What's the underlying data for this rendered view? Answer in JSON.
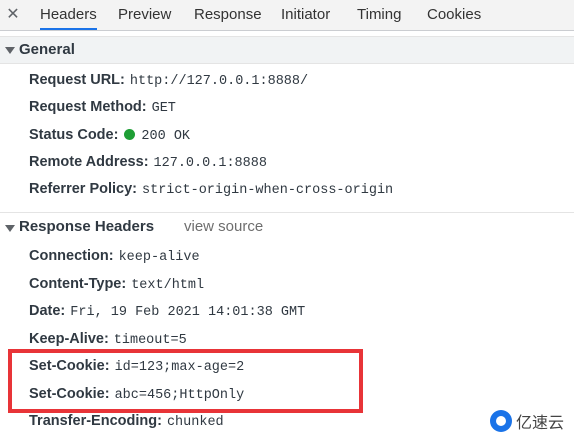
{
  "tabs": {
    "close_icon": "✕",
    "items": [
      "Headers",
      "Preview",
      "Response",
      "Initiator",
      "Timing",
      "Cookies"
    ],
    "active": "Headers"
  },
  "general": {
    "title": "General",
    "request_url_key": "Request URL:",
    "request_url_val": "http://127.0.0.1:8888/",
    "request_method_key": "Request Method:",
    "request_method_val": "GET",
    "status_code_key": "Status Code:",
    "status_code_val": "200 OK",
    "status_color": "#1e9e35",
    "remote_address_key": "Remote Address:",
    "remote_address_val": "127.0.0.1:8888",
    "referrer_policy_key": "Referrer Policy:",
    "referrer_policy_val": "strict-origin-when-cross-origin"
  },
  "response_headers": {
    "title": "Response Headers",
    "view_source": "view source",
    "connection_key": "Connection:",
    "connection_val": "keep-alive",
    "content_type_key": "Content-Type:",
    "content_type_val": "text/html",
    "date_key": "Date:",
    "date_val": "Fri, 19 Feb 2021 14:01:38 GMT",
    "keep_alive_key": "Keep-Alive:",
    "keep_alive_val": "timeout=5",
    "set_cookie_1_key": "Set-Cookie:",
    "set_cookie_1_val": "id=123;max-age=2",
    "set_cookie_2_key": "Set-Cookie:",
    "set_cookie_2_val": "abc=456;HttpOnly",
    "transfer_encoding_key": "Transfer-Encoding:",
    "transfer_encoding_val": "chunked"
  },
  "annotation": {
    "highlight_color": "#e83438"
  },
  "watermark": {
    "text": "亿速云"
  },
  "colors": {
    "accent": "#1a73e8",
    "tabbar_bg": "#f3f3f3",
    "section_bg": "#f1f3f4"
  }
}
